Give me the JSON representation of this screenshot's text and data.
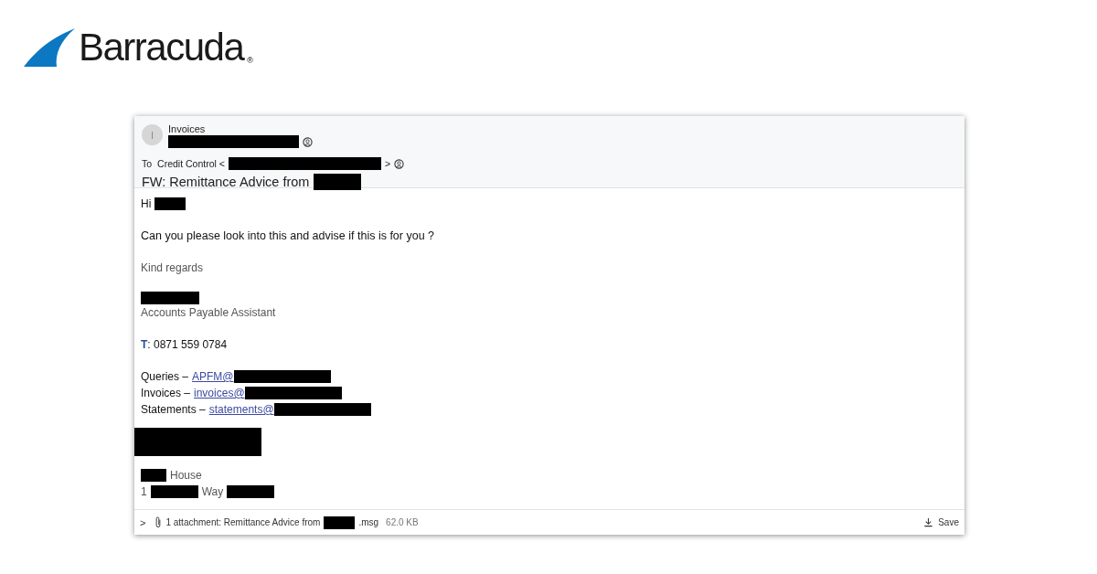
{
  "logo": {
    "name": "Barracuda",
    "mark": "®"
  },
  "email": {
    "header": {
      "avatar": "I",
      "sender": "Invoices",
      "sender_address": {
        "kind": "redacted_wide"
      },
      "to_label": "To",
      "recipient": "Credit Control <",
      "recipient_address": {
        "kind": "redacted_widest"
      },
      "recipient_end": ">",
      "subject": "FW: Remittance Advice from",
      "subject_redaction": {
        "kind": "redacted_medium"
      }
    },
    "body": [
      [
        {
          "kind": "plain",
          "segments": [
            {
              "kind": "text",
              "text": "Hi"
            },
            {
              "kind": "redacted_short"
            }
          ]
        }
      ],
      [
        {
          "kind": "strong",
          "segments": [
            {
              "kind": "text",
              "text": "Can you please look into this and advise if this is for you ?"
            }
          ]
        }
      ],
      [
        {
          "kind": "muted",
          "segments": [
            {
              "kind": "text",
              "text": "Kind regards"
            }
          ]
        }
      ],
      [
        {
          "kind": "plain",
          "segments": [
            {
              "kind": "redacted_name"
            }
          ]
        },
        {
          "kind": "muted",
          "segments": [
            {
              "kind": "text",
              "text": "Accounts Payable Assistant"
            }
          ]
        }
      ],
      [
        {
          "kind": "plain",
          "segments": [
            {
              "kind": "accent",
              "text": "T"
            },
            {
              "kind": "text",
              "text": ": 0871 559 0784"
            }
          ]
        }
      ],
      [
        {
          "kind": "plain",
          "segments": [
            {
              "kind": "text",
              "text": "Queries –"
            },
            {
              "kind": "link",
              "text": "APFM@"
            },
            {
              "kind": "redacted_long"
            }
          ]
        },
        {
          "kind": "plain",
          "segments": [
            {
              "kind": "text",
              "text": "Invoices –"
            },
            {
              "kind": "link",
              "text": "invoices@"
            },
            {
              "kind": "redacted_long"
            }
          ]
        },
        {
          "kind": "plain",
          "segments": [
            {
              "kind": "text",
              "text": "Statements –"
            },
            {
              "kind": "link",
              "text": "statements@"
            },
            {
              "kind": "redacted_long"
            }
          ]
        }
      ],
      [
        {
          "kind": "plain",
          "segments": [
            {
              "kind": "redacted_block"
            }
          ]
        }
      ],
      [
        {
          "kind": "muted",
          "segments": [
            {
              "kind": "redacted_tiny"
            },
            {
              "kind": "text",
              "text": "House"
            }
          ]
        },
        {
          "kind": "muted",
          "segments": [
            {
              "kind": "text",
              "text": "1"
            },
            {
              "kind": "redacted_medium"
            },
            {
              "kind": "text",
              "text": "Way"
            },
            {
              "kind": "redacted_medium"
            }
          ]
        }
      ]
    ],
    "attachment": {
      "expander": ">",
      "label": "1 attachment: Remittance Advice from",
      "redaction": {
        "kind": "redacted_short"
      },
      "extension": ".msg",
      "file_size": "62.0 KB",
      "save": "Save"
    }
  }
}
